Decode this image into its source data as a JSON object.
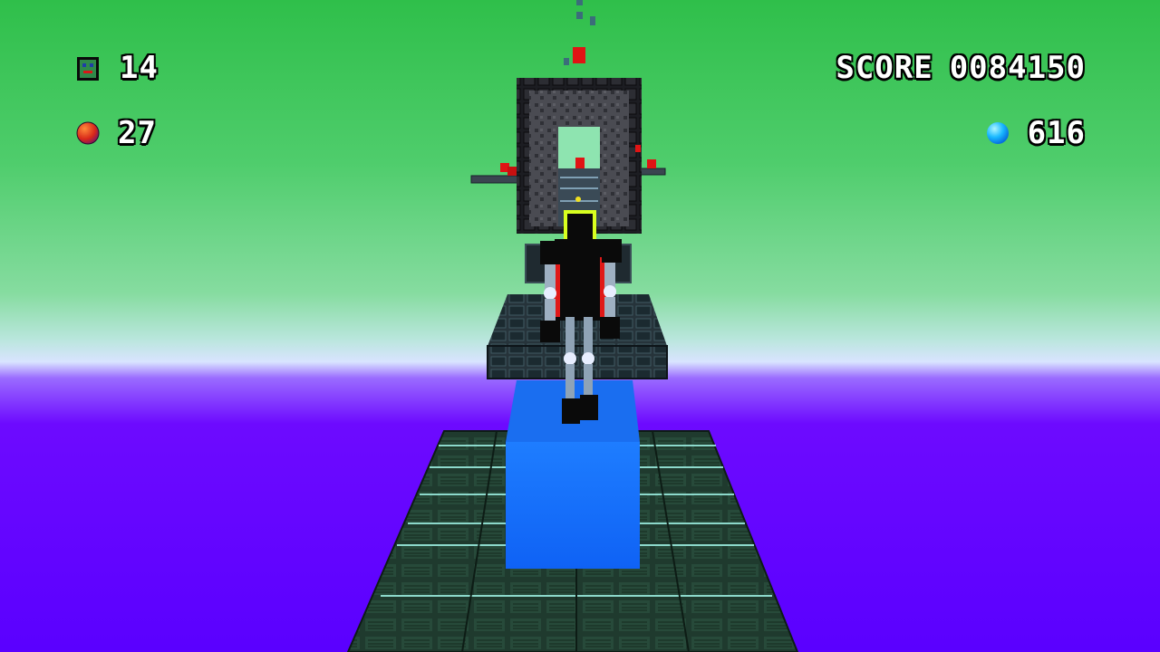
{
  "hud": {
    "lives": {
      "icon": "robot-face-icon",
      "value": "14"
    },
    "orbs": {
      "icon": "red-orb-icon",
      "value": "27"
    },
    "score": {
      "label": "SCORE",
      "value": "0084150"
    },
    "gems": {
      "icon": "blue-gem-icon",
      "value": "616"
    }
  },
  "colors": {
    "sky_top": "#2fbf4a",
    "sky_mid": "#74d98c",
    "horizon_glow": "#cfe0ff",
    "void_purple": "#6d0aff",
    "void_deep": "#5a00ff",
    "tile_dark": "#1f3a2e",
    "tile_seam": "#9ff4e6",
    "block_blue": "#1a73ff",
    "gate_gray": "#3e3f45",
    "robot_black": "#0a0a0a",
    "robot_accent_red": "#e01818",
    "robot_visor": "#d8ff1f",
    "pickup_red": "#e01414"
  }
}
